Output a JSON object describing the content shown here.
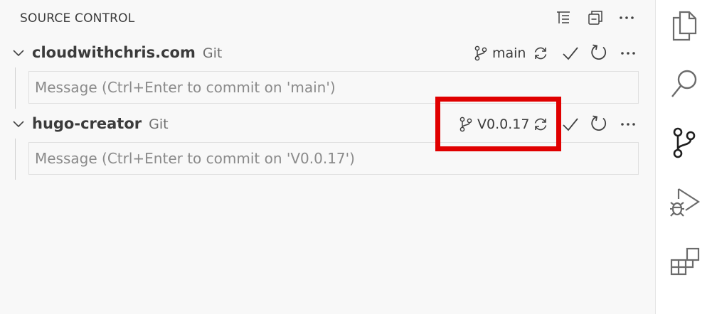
{
  "panel": {
    "title": "SOURCE CONTROL",
    "actions": [
      "tree-view-icon",
      "collapse-all-icon",
      "more-actions-icon"
    ]
  },
  "repositories": [
    {
      "name": "cloudwithchris.com",
      "kind": "Git",
      "branch": "main",
      "message_placeholder": "Message (Ctrl+Enter to commit on 'main')",
      "message_value": ""
    },
    {
      "name": "hugo-creator",
      "kind": "Git",
      "branch": "V0.0.17",
      "message_placeholder": "Message (Ctrl+Enter to commit on 'V0.0.17')",
      "message_value": ""
    }
  ],
  "activity_bar": {
    "items": [
      "explorer-icon",
      "search-icon",
      "source-control-icon",
      "run-debug-icon",
      "extensions-icon"
    ],
    "active": "source-control-icon"
  },
  "colors": {
    "highlight": "#e00000",
    "background": "#f8f8f8",
    "activity_bar": "#ffffff",
    "text": "#3b3b3b",
    "muted": "#717171"
  }
}
